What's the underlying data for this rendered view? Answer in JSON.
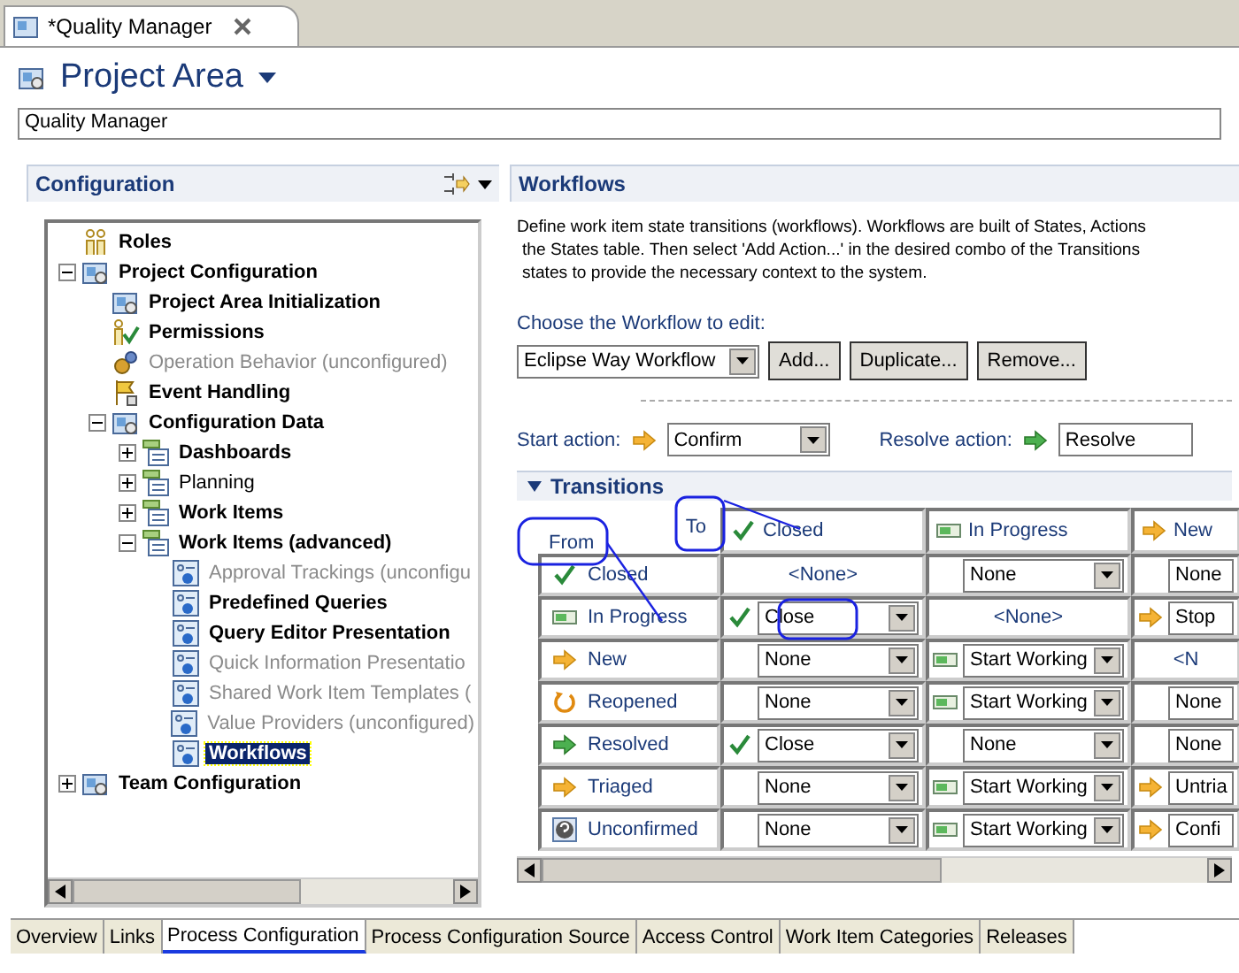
{
  "editor_tab": {
    "title": "*Quality Manager"
  },
  "header": {
    "title": "Project Area"
  },
  "name_field": {
    "value": "Quality Manager"
  },
  "configuration": {
    "title": "Configuration",
    "tree": [
      {
        "label": "Roles",
        "kind": "roles",
        "bold": true,
        "disabled": false,
        "selected": false
      },
      {
        "label": "Project Configuration",
        "kind": "project",
        "bold": true,
        "disabled": false,
        "selected": false,
        "expanded": true,
        "children": [
          {
            "label": "Project Area Initialization",
            "kind": "init",
            "bold": true,
            "disabled": false,
            "selected": false
          },
          {
            "label": "Permissions",
            "kind": "permissions",
            "bold": true,
            "disabled": false,
            "selected": false
          },
          {
            "label": "Operation Behavior (unconfigured)",
            "kind": "behavior",
            "bold": false,
            "disabled": true,
            "selected": false
          },
          {
            "label": "Event Handling",
            "kind": "events",
            "bold": true,
            "disabled": false,
            "selected": false
          },
          {
            "label": "Configuration Data",
            "kind": "data",
            "bold": true,
            "disabled": false,
            "selected": false,
            "expanded": true,
            "children": [
              {
                "label": "Dashboards",
                "kind": "folder",
                "bold": true,
                "disabled": false,
                "selected": false,
                "expanded": false
              },
              {
                "label": "Planning",
                "kind": "folder",
                "bold": false,
                "disabled": false,
                "selected": false,
                "expanded": false
              },
              {
                "label": "Work Items",
                "kind": "folder",
                "bold": true,
                "disabled": false,
                "selected": false,
                "expanded": false
              },
              {
                "label": "Work Items (advanced)",
                "kind": "folder",
                "bold": true,
                "disabled": false,
                "selected": false,
                "expanded": true,
                "children": [
                  {
                    "label": "Approval Trackings (unconfigu",
                    "kind": "config",
                    "bold": false,
                    "disabled": true,
                    "selected": false
                  },
                  {
                    "label": "Predefined Queries",
                    "kind": "config",
                    "bold": true,
                    "disabled": false,
                    "selected": false
                  },
                  {
                    "label": "Query Editor Presentation",
                    "kind": "config",
                    "bold": true,
                    "disabled": false,
                    "selected": false
                  },
                  {
                    "label": "Quick Information Presentatio",
                    "kind": "config",
                    "bold": false,
                    "disabled": true,
                    "selected": false
                  },
                  {
                    "label": "Shared Work Item Templates (",
                    "kind": "config",
                    "bold": false,
                    "disabled": true,
                    "selected": false
                  },
                  {
                    "label": "Value Providers (unconfigured)",
                    "kind": "config",
                    "bold": false,
                    "disabled": true,
                    "selected": false
                  },
                  {
                    "label": "Workflows",
                    "kind": "config",
                    "bold": true,
                    "disabled": false,
                    "selected": true
                  }
                ]
              }
            ]
          }
        ]
      },
      {
        "label": "Team Configuration",
        "kind": "team",
        "bold": true,
        "disabled": false,
        "selected": false,
        "expanded": false
      }
    ]
  },
  "workflows": {
    "title": "Workflows",
    "description": [
      "Define work item state transitions (workflows). Workflows are built of States, Actions",
      "the States table. Then select 'Add Action...' in the desired combo of the Transitions",
      "states to provide the necessary context to the system."
    ],
    "chooser_label": "Choose the Workflow to edit:",
    "workflow_combo": {
      "value": "Eclipse Way Workflow"
    },
    "buttons": [
      "Add...",
      "Duplicate...",
      "Remove..."
    ],
    "start_action": {
      "label": "Start action:",
      "value": "Confirm"
    },
    "resolve_action": {
      "label": "Resolve action:",
      "value": "Resolve"
    },
    "transitions": {
      "title": "Transitions",
      "expanded": true,
      "from_label": "From",
      "to_label": "To",
      "columns": [
        {
          "label": "Closed",
          "kind": "closed"
        },
        {
          "label": "In Progress",
          "kind": "inprogress"
        },
        {
          "label": "New",
          "kind": "new"
        }
      ],
      "rows": [
        {
          "label": "Closed",
          "kind": "closed",
          "cells": [
            {
              "kind": "none",
              "value": "<None>"
            },
            {
              "kind": "combo",
              "value": "None"
            },
            {
              "kind": "combo",
              "value": "None"
            }
          ]
        },
        {
          "label": "In Progress",
          "kind": "inprogress",
          "cells": [
            {
              "kind": "action",
              "value": "Close"
            },
            {
              "kind": "none",
              "value": "<None>"
            },
            {
              "kind": "action",
              "value": "Stop"
            }
          ]
        },
        {
          "label": "New",
          "kind": "new",
          "cells": [
            {
              "kind": "combo",
              "value": "None"
            },
            {
              "kind": "action",
              "value": "Start Working"
            },
            {
              "kind": "none",
              "value": "<N"
            }
          ]
        },
        {
          "label": "Reopened",
          "kind": "reopened",
          "cells": [
            {
              "kind": "combo",
              "value": "None"
            },
            {
              "kind": "action",
              "value": "Start Working"
            },
            {
              "kind": "combo",
              "value": "None"
            }
          ]
        },
        {
          "label": "Resolved",
          "kind": "resolved",
          "cells": [
            {
              "kind": "action",
              "value": "Close"
            },
            {
              "kind": "combo",
              "value": "None"
            },
            {
              "kind": "combo",
              "value": "None"
            }
          ]
        },
        {
          "label": "Triaged",
          "kind": "triaged",
          "cells": [
            {
              "kind": "combo",
              "value": "None"
            },
            {
              "kind": "action",
              "value": "Start Working"
            },
            {
              "kind": "action",
              "value": "Untria"
            }
          ]
        },
        {
          "label": "Unconfirmed",
          "kind": "unconfirmed",
          "cells": [
            {
              "kind": "combo",
              "value": "None"
            },
            {
              "kind": "action",
              "value": "Start Working"
            },
            {
              "kind": "action",
              "value": "Confi"
            }
          ]
        }
      ]
    }
  },
  "bottom_tabs": [
    {
      "label": "Overview",
      "selected": false
    },
    {
      "label": "Links",
      "selected": false
    },
    {
      "label": "Process Configuration",
      "selected": true
    },
    {
      "label": "Process Configuration Source",
      "selected": false
    },
    {
      "label": "Access Control",
      "selected": false
    },
    {
      "label": "Work Item Categories",
      "selected": false
    },
    {
      "label": "Releases",
      "selected": false
    }
  ]
}
